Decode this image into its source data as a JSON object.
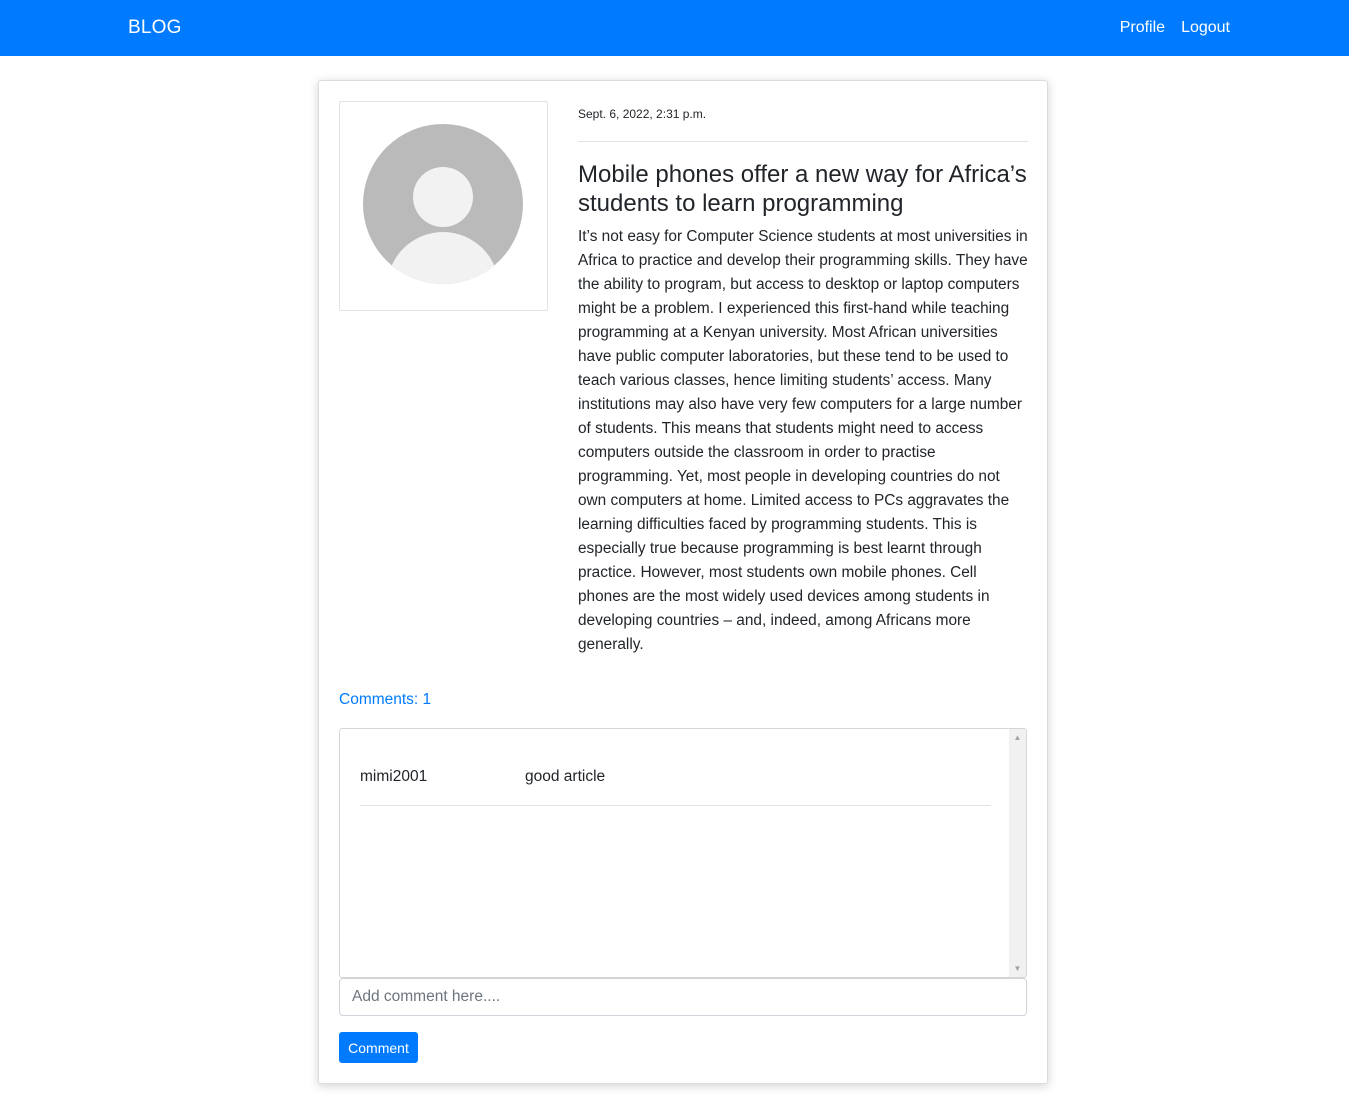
{
  "navbar": {
    "brand": "BLOG",
    "links": [
      "Profile",
      "Logout"
    ]
  },
  "post": {
    "date": "Sept. 6, 2022, 2:31 p.m.",
    "title": "Mobile phones offer a new way for Africa’s students to learn programming",
    "body": "It’s not easy for Computer Science students at most universities in Africa to practice and develop their programming skills. They have the ability to program, but access to desktop or laptop computers might be a problem. I experienced this first-hand while teaching programming at a Kenyan university. Most African universities have public computer laboratories, but these tend to be used to teach various classes, hence limiting students’ access. Many institutions may also have very few computers for a large number of students. This means that students might need to access computers outside the classroom in order to practise programming. Yet, most people in developing countries do not own computers at home. Limited access to PCs aggravates the learning difficulties faced by programming students. This is especially true because programming is best learnt through practice. However, most students own mobile phones. Cell phones are the most widely used devices among students in developing countries – and, indeed, among Africans more generally.",
    "avatar_icon": "default-user-avatar"
  },
  "comments": {
    "count_label": "Comments: 1",
    "items": [
      {
        "user": "mimi2001",
        "text": "good article"
      }
    ],
    "input_placeholder": "Add comment here....",
    "submit_label": "Comment"
  },
  "colors": {
    "primary": "#007bff",
    "text": "#212529",
    "avatar_bg": "#bababa",
    "avatar_fg": "#f2f2f2"
  }
}
